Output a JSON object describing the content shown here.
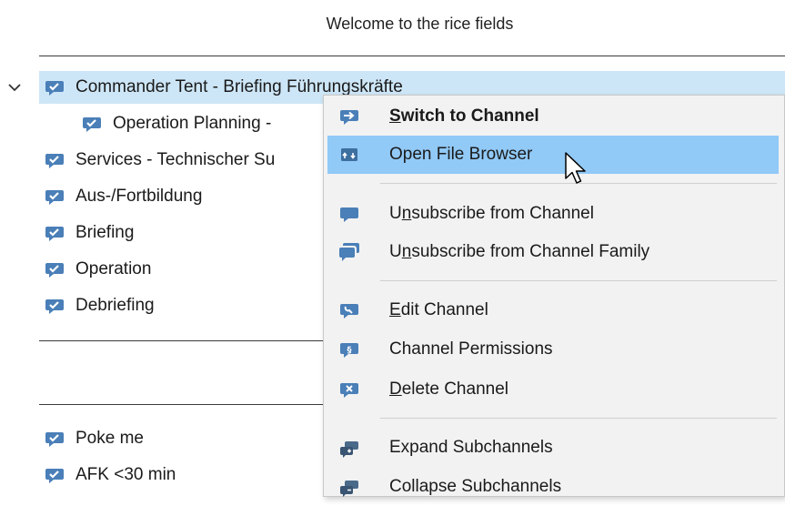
{
  "header": {
    "title": "Welcome to the rice fields"
  },
  "tree": {
    "items": [
      {
        "label": "Commander Tent - Briefing Führungskräfte"
      },
      {
        "label": "Operation Planning -"
      },
      {
        "label": "Services - Technischer Su"
      },
      {
        "label": "Aus-/Fortbildung"
      },
      {
        "label": "Briefing"
      },
      {
        "label": "Operation"
      },
      {
        "label": "Debriefing"
      }
    ],
    "bottom_items": [
      {
        "label": "Poke me"
      },
      {
        "label": "AFK <30 min"
      }
    ]
  },
  "context_menu": {
    "items": [
      {
        "pre": "",
        "ul": "S",
        "post": "witch to Channel",
        "icon": "channel-switch-icon",
        "bold": true
      },
      {
        "pre": "",
        "ul": "",
        "post": "Open File Browser",
        "icon": "file-browser-icon"
      },
      {
        "pre": "U",
        "ul": "n",
        "post": "subscribe from Channel",
        "icon": "unsubscribe-icon"
      },
      {
        "pre": "U",
        "ul": "n",
        "post": "subscribe from Channel Family",
        "icon": "unsubscribe-family-icon"
      },
      {
        "pre": "",
        "ul": "E",
        "post": "dit Channel",
        "icon": "edit-channel-icon"
      },
      {
        "pre": "",
        "ul": "",
        "post": "Channel Permissions",
        "icon": "permissions-icon"
      },
      {
        "pre": "",
        "ul": "D",
        "post": "elete Channel",
        "icon": "delete-channel-icon"
      },
      {
        "pre": "",
        "ul": "",
        "post": "Expand Subchannels",
        "icon": "expand-subchannels-icon"
      },
      {
        "pre": "",
        "ul": "",
        "post": "Collapse Subchannels",
        "icon": "collapse-subchannels-icon"
      }
    ]
  },
  "colors": {
    "selection": "#cde6f7",
    "menu_hover": "#91c9f7",
    "icon_blue": "#4a7fb8"
  }
}
